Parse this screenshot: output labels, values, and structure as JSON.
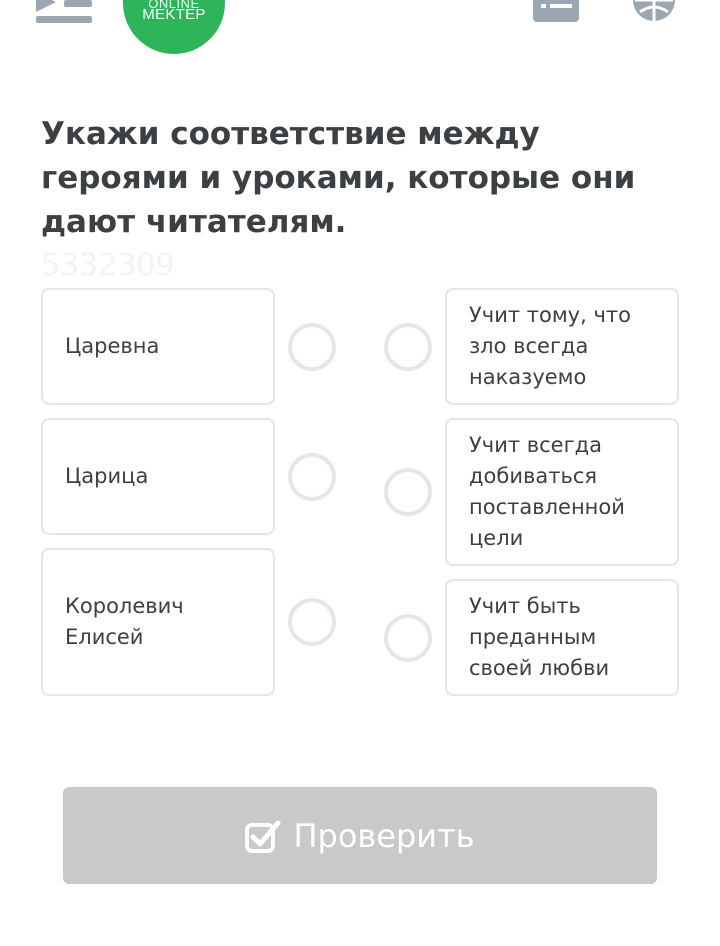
{
  "header": {
    "logo_line1": "ONLINE",
    "logo_line2": "MEKTEP",
    "icons": [
      "menu-icon",
      "list-icon",
      "globe-icon"
    ],
    "accent_color": "#2eb55a"
  },
  "question": {
    "title": "Укажи соответствие между героями и уроками, которые они дают читателям.",
    "watermark": "5332309"
  },
  "left_items": [
    {
      "label": "Царевна"
    },
    {
      "label": "Царица"
    },
    {
      "label": "Королевич Елисей"
    }
  ],
  "right_items": [
    {
      "label": "Учит тому, что зло всегда наказуемо"
    },
    {
      "label": "Учит всегда добиваться поставленной цели"
    },
    {
      "label": "Учит быть преданным своей любви"
    }
  ],
  "actions": {
    "check_label": "Проверить",
    "check_icon": "checkbox-check-icon",
    "button_color": "#c9c9c9"
  }
}
